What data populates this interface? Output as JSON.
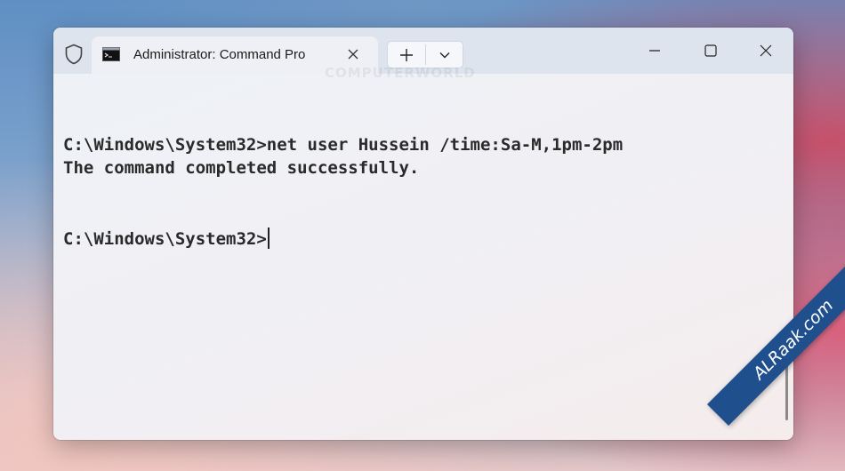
{
  "window": {
    "tab_title": "Administrator: Command Pro",
    "tab_icon": "command-prompt-icon",
    "new_tab_icon": "plus-icon",
    "dropdown_icon": "chevron-down-icon",
    "caption_buttons": [
      "minimize",
      "maximize",
      "close"
    ]
  },
  "terminal": {
    "watermark": "COMPUTERWORLD",
    "lines": [
      "C:\\Windows\\System32>net user Hussein /time:Sa-M,1pm-2pm",
      "The command completed successfully.",
      "",
      "",
      "C:\\Windows\\System32>"
    ]
  },
  "watermark_site": "ALRaak.com",
  "colors": {
    "titlebar": "#dde4ee",
    "terminal_bg": "#eef0f5",
    "ribbon": "#1f4f8d",
    "text": "#2a2a2a"
  }
}
